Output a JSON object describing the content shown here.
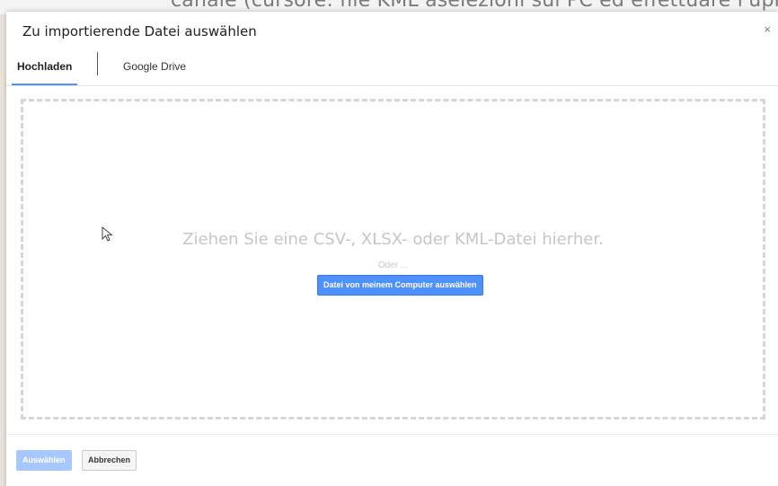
{
  "background": {
    "partial_text": "canale (cursore: file KML aselezioni sul PC ed effettuare l'upl"
  },
  "dialog": {
    "title": "Zu importierende Datei auswählen",
    "close_label": "×"
  },
  "tabs": [
    {
      "label": "Hochladen",
      "active": true
    },
    {
      "label": "Google Drive",
      "active": false
    }
  ],
  "dropzone": {
    "drop_text": "Ziehen Sie eine CSV-, XLSX- oder KML-Datei hierher.",
    "or_text": "Oder ...",
    "pick_button": "Datei von meinem Computer auswählen"
  },
  "footer": {
    "select_button": "Auswählen",
    "cancel_button": "Abbrechen"
  },
  "colors": {
    "accent": "#4d90fe",
    "disabled_accent": "#a6c8ff",
    "dropzone_border": "#d6d6d6"
  },
  "icons": {
    "close": "close-icon",
    "cursor": "mouse-pointer-icon"
  }
}
